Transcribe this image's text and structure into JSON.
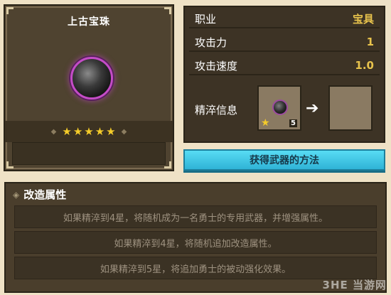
{
  "item": {
    "name": "上古宝珠",
    "icon": "dark-orb-icon",
    "stars": 5,
    "star_glyph": "★"
  },
  "stats": {
    "rows": [
      {
        "label": "职业",
        "value": "宝具"
      },
      {
        "label": "攻击力",
        "value": "1"
      },
      {
        "label": "攻击速度",
        "value": "1.0"
      }
    ],
    "refine_label": "精淬信息",
    "refine_level": "5"
  },
  "acquire_button": "获得武器的方法",
  "modify": {
    "title": "改造属性",
    "rows": [
      "如果精淬到4星，将随机成为一名勇士的专用武器，并增强属性。",
      "如果精淬到4星，将随机追加改造属性。",
      "如果精淬到5星，将追加勇士的被动强化效果。"
    ]
  },
  "watermark": "3HE 当游网",
  "colors": {
    "accent_gold": "#e8c34c",
    "button_cyan": "#2fb3d6",
    "orb_glow": "#c44cc7"
  }
}
